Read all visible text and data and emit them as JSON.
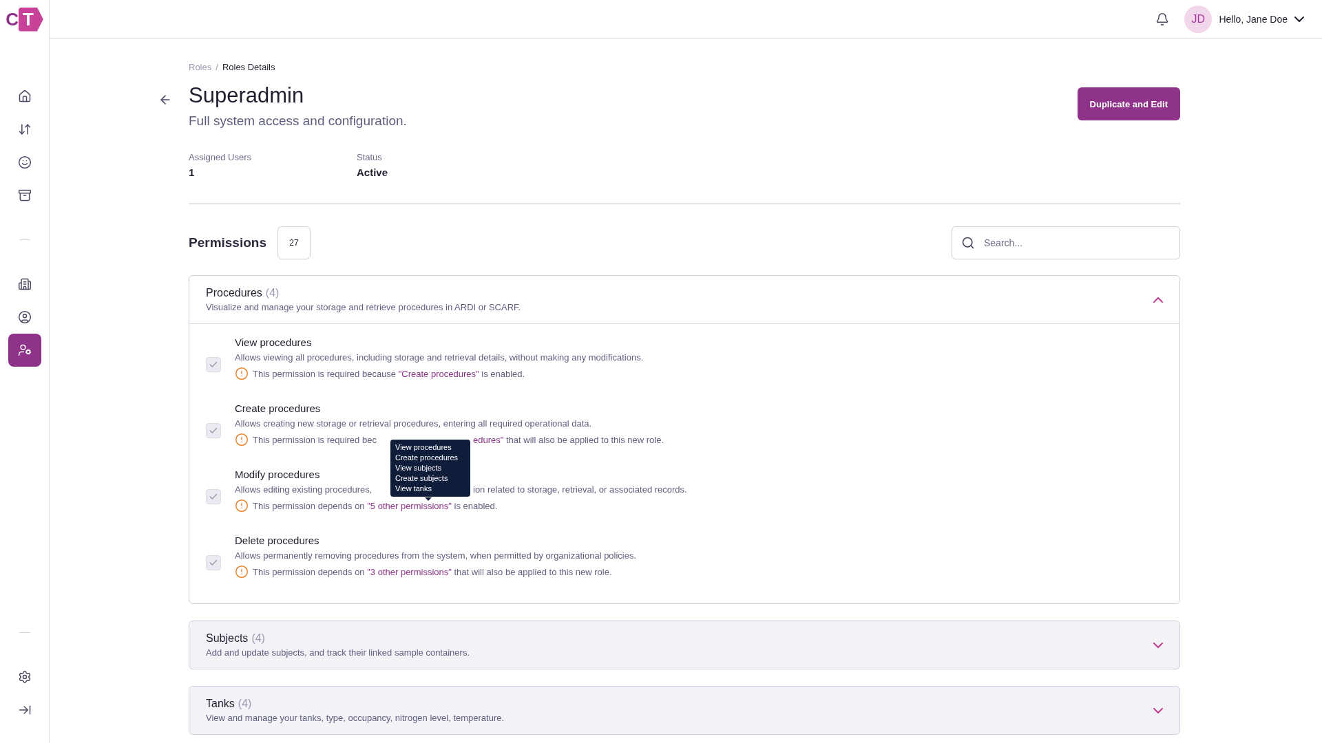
{
  "logo": {
    "first": "C",
    "second": "T"
  },
  "sidebar": {
    "items": [
      {
        "kind": "link",
        "selected": false
      },
      {
        "kind": "link",
        "selected": false
      },
      {
        "kind": "link",
        "selected": false
      },
      {
        "kind": "link",
        "selected": false
      },
      {
        "kind": "divider"
      },
      {
        "kind": "link",
        "selected": false
      },
      {
        "kind": "link",
        "selected": false
      },
      {
        "kind": "link",
        "selected": true
      }
    ],
    "bottom_items": [
      {
        "kind": "divider"
      },
      {
        "kind": "link",
        "selected": false
      },
      {
        "kind": "link",
        "selected": false
      }
    ]
  },
  "header": {
    "avatar_initials": "JD",
    "greeting": "Hello, Jane Doe"
  },
  "breadcrumb": [
    {
      "label": "Roles",
      "current": false
    },
    {
      "label": "Roles Details",
      "current": true
    }
  ],
  "separator": "/",
  "role": {
    "title": "Superadmin",
    "description": "Full system access and configuration.",
    "action": "Duplicate and Edit"
  },
  "stats": [
    {
      "label": "Assigned Users",
      "value": "1"
    },
    {
      "label": "Status",
      "value": "Active"
    }
  ],
  "permissions": {
    "title": "Permissions",
    "count": "27",
    "search": {
      "placeholder": "Search..."
    },
    "groups": [
      {
        "title": "Procedures",
        "count": "(4)",
        "description": "Visualize and manage your storage and retrieve procedures in ARDI or SCARF.",
        "expanded": true,
        "items": [
          {
            "title": "View procedures",
            "description": "Allows viewing all procedures, including storage and retrieval details, without making any modifications.",
            "checked": true,
            "disabled": true,
            "note": [
              {
                "kind": "text",
                "text": "This permission is required because "
              },
              {
                "kind": "link",
                "text": "\"Create procedures\""
              },
              {
                "kind": "text",
                "text": " is enabled."
              }
            ]
          },
          {
            "title": "Create procedures",
            "description": "Allows creating new storage or retrieval procedures, entering all required operational data.",
            "checked": true,
            "disabled": true,
            "note": [
              {
                "kind": "text",
                "text": "This permission is required bec"
              },
              {
                "kind": "covered"
              },
              {
                "kind": "link",
                "text": "edures\""
              },
              {
                "kind": "text",
                "text": " that will also be applied to this new role."
              }
            ]
          },
          {
            "title": "Modify procedures",
            "description": [
              {
                "kind": "text",
                "text": "Allows editing existing procedures,"
              },
              {
                "kind": "covered",
                "tooltip": [
                  "View procedures",
                  "Create procedures",
                  "View subjects",
                  "Create subjects",
                  "View tanks"
                ]
              },
              {
                "kind": "text",
                "text": "ion related to storage, retrieval, or associated records."
              }
            ],
            "checked": true,
            "disabled": true,
            "note": [
              {
                "kind": "text",
                "text": "This permission depends on "
              },
              {
                "kind": "link",
                "text": "\"5 other permissions\""
              },
              {
                "kind": "text",
                "text": " is enabled."
              }
            ]
          },
          {
            "title": "Delete procedures",
            "description": "Allows permanently removing procedures from the system, when permitted by organizational policies.",
            "checked": true,
            "disabled": true,
            "note": [
              {
                "kind": "text",
                "text": "This permission depends on "
              },
              {
                "kind": "link",
                "text": "\"3 other permissions\""
              },
              {
                "kind": "text",
                "text": " that will also be applied to this new role."
              }
            ]
          }
        ]
      },
      {
        "title": "Subjects",
        "count": "(4)",
        "description": "Add and update subjects, and track their linked sample containers.",
        "expanded": false
      },
      {
        "title": "Tanks",
        "count": "(4)",
        "description": "View and manage your tanks, type, occupancy, nitrogen level, temperature.",
        "expanded": false
      }
    ]
  }
}
